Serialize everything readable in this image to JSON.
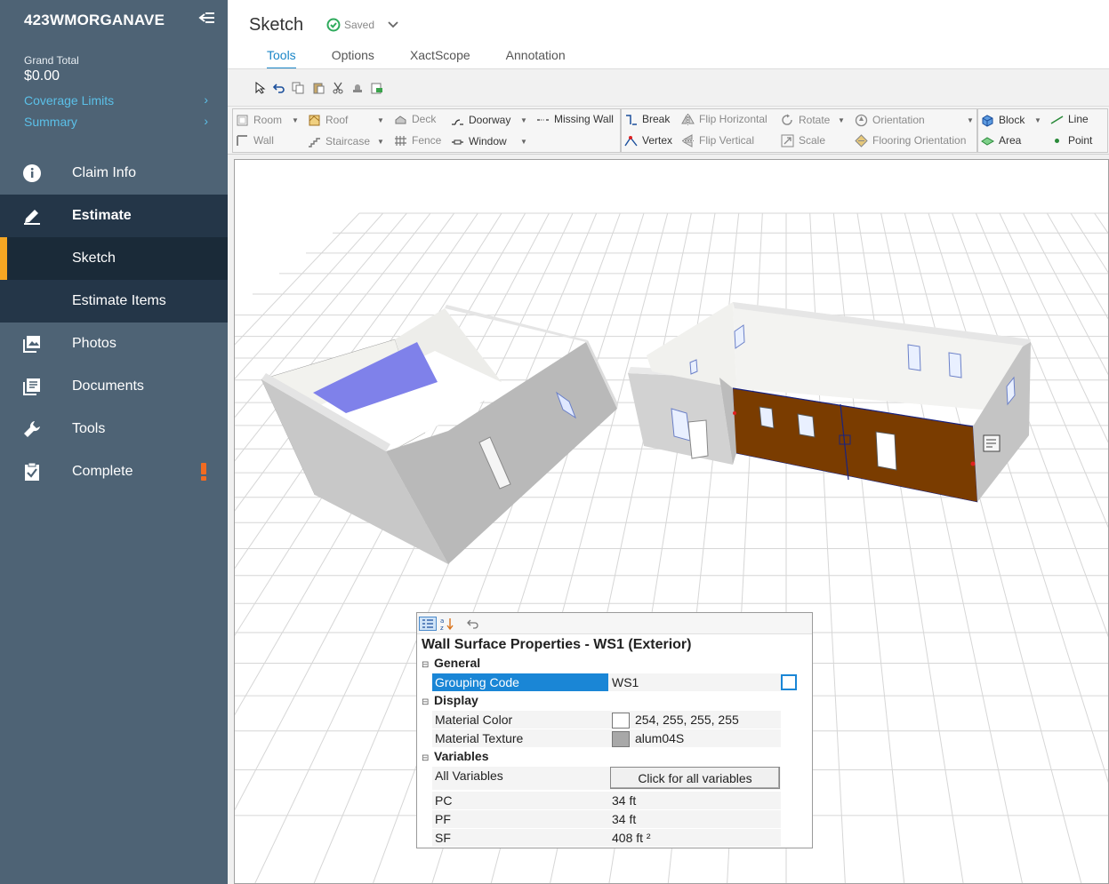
{
  "sidebar": {
    "project_title": "423WMORGANAVE",
    "grand_total_label": "Grand Total",
    "grand_total_value": "$0.00",
    "links": [
      "Coverage Limits",
      "Summary"
    ],
    "nav": [
      {
        "label": "Claim Info",
        "icon": "info-icon"
      },
      {
        "label": "Estimate",
        "icon": "edit-icon"
      },
      {
        "label": "Sketch",
        "icon": ""
      },
      {
        "label": "Estimate Items",
        "icon": ""
      },
      {
        "label": "Photos",
        "icon": "photos-icon"
      },
      {
        "label": "Documents",
        "icon": "documents-icon"
      },
      {
        "label": "Tools",
        "icon": "wrench-icon"
      },
      {
        "label": "Complete",
        "icon": "clipboard-check-icon"
      }
    ],
    "warning_color": "#f26b21",
    "accent_color": "#f5a623"
  },
  "header": {
    "title": "Sketch",
    "status": "Saved",
    "tabs": [
      "Tools",
      "Options",
      "XactScope",
      "Annotation"
    ],
    "active_tab": "Tools"
  },
  "ribbon": {
    "group1": [
      "Room",
      "Roof",
      "Deck",
      "Doorway",
      "Missing Wall",
      "Wall",
      "Staircase",
      "Fence",
      "Window"
    ],
    "group2": [
      "Break",
      "Flip Horizontal",
      "Rotate",
      "Orientation",
      "Vertex",
      "Flip Vertical",
      "Scale",
      "Flooring Orientation"
    ],
    "group3": [
      "Block",
      "Line",
      "Area",
      "Point"
    ]
  },
  "properties": {
    "title": "Wall Surface Properties - WS1 (Exterior)",
    "categories": {
      "general": "General",
      "display": "Display",
      "variables": "Variables"
    },
    "grouping_code": {
      "name": "Grouping Code",
      "value": "WS1"
    },
    "material_color": {
      "name": "Material Color",
      "value": "254, 255, 255, 255"
    },
    "material_texture": {
      "name": "Material Texture",
      "value": "alum04S"
    },
    "all_variables": {
      "name": "All Variables",
      "button": "Click for all variables"
    },
    "pc": {
      "name": "PC",
      "value": "34 ft"
    },
    "pf": {
      "name": "PF",
      "value": "34 ft"
    },
    "sf": {
      "name": "SF",
      "value": "408 ft ²"
    }
  },
  "colors": {
    "sidebar_bg": "#4e6375",
    "link": "#5bc0e8",
    "selected_wall": "#7a3c00",
    "floor_fill": "#8a8cf0",
    "tab_active": "#1a86c7"
  }
}
